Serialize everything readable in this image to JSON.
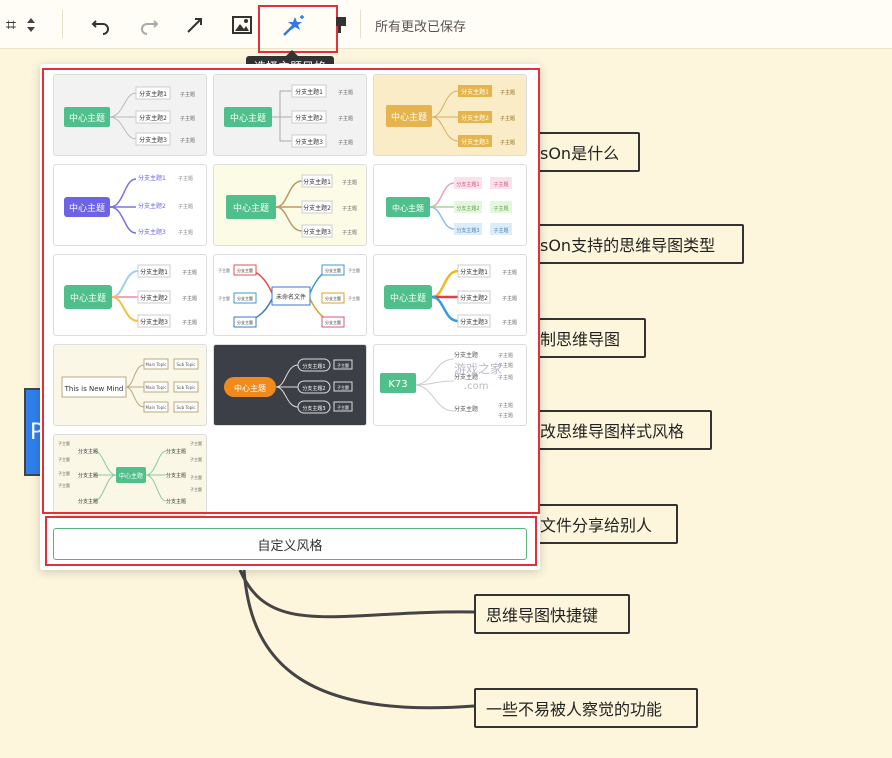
{
  "toolbar": {
    "left_partial_glyph": "⌗",
    "sort_icon": "swap-vert-icon",
    "undo_icon": "undo-icon",
    "redo_icon": "redo-icon",
    "arrow_icon": "arrow-icon",
    "image_icon": "image-icon",
    "theme_icon": "magic-wand-icon",
    "format_icon": "format-painter-icon",
    "status": "所有更改已保存",
    "tooltip": "选择主题风格"
  },
  "canvas": {
    "nodes": [
      "sOn是什么",
      "sOn支持的思维导图类型",
      "制思维导图",
      "改思维导图样式风格",
      "文件分享给别人",
      "思维导图快捷键",
      "一些不易被人察觉的功能"
    ],
    "left_blue_letter": "P"
  },
  "themes": {
    "center": "中心主题",
    "branch1": "分支主题1",
    "branch2": "分支主题2",
    "branch3": "分支主题3",
    "sub": "子主题",
    "new_mind": "This is New Mind",
    "untitled": "未命名文件",
    "main_topic": "Main Topic",
    "sub_topic": "Sub Topic",
    "branch_plain": "分支主题",
    "watermark": "游戏之家",
    "watermark_com": ".com",
    "watermark_logo": "K73"
  },
  "custom_style_button": "自定义风格",
  "colors": {
    "accent_green": "#4fbf8b",
    "highlight_red": "#e0303a",
    "canvas_bg": "#fdf6dc"
  }
}
